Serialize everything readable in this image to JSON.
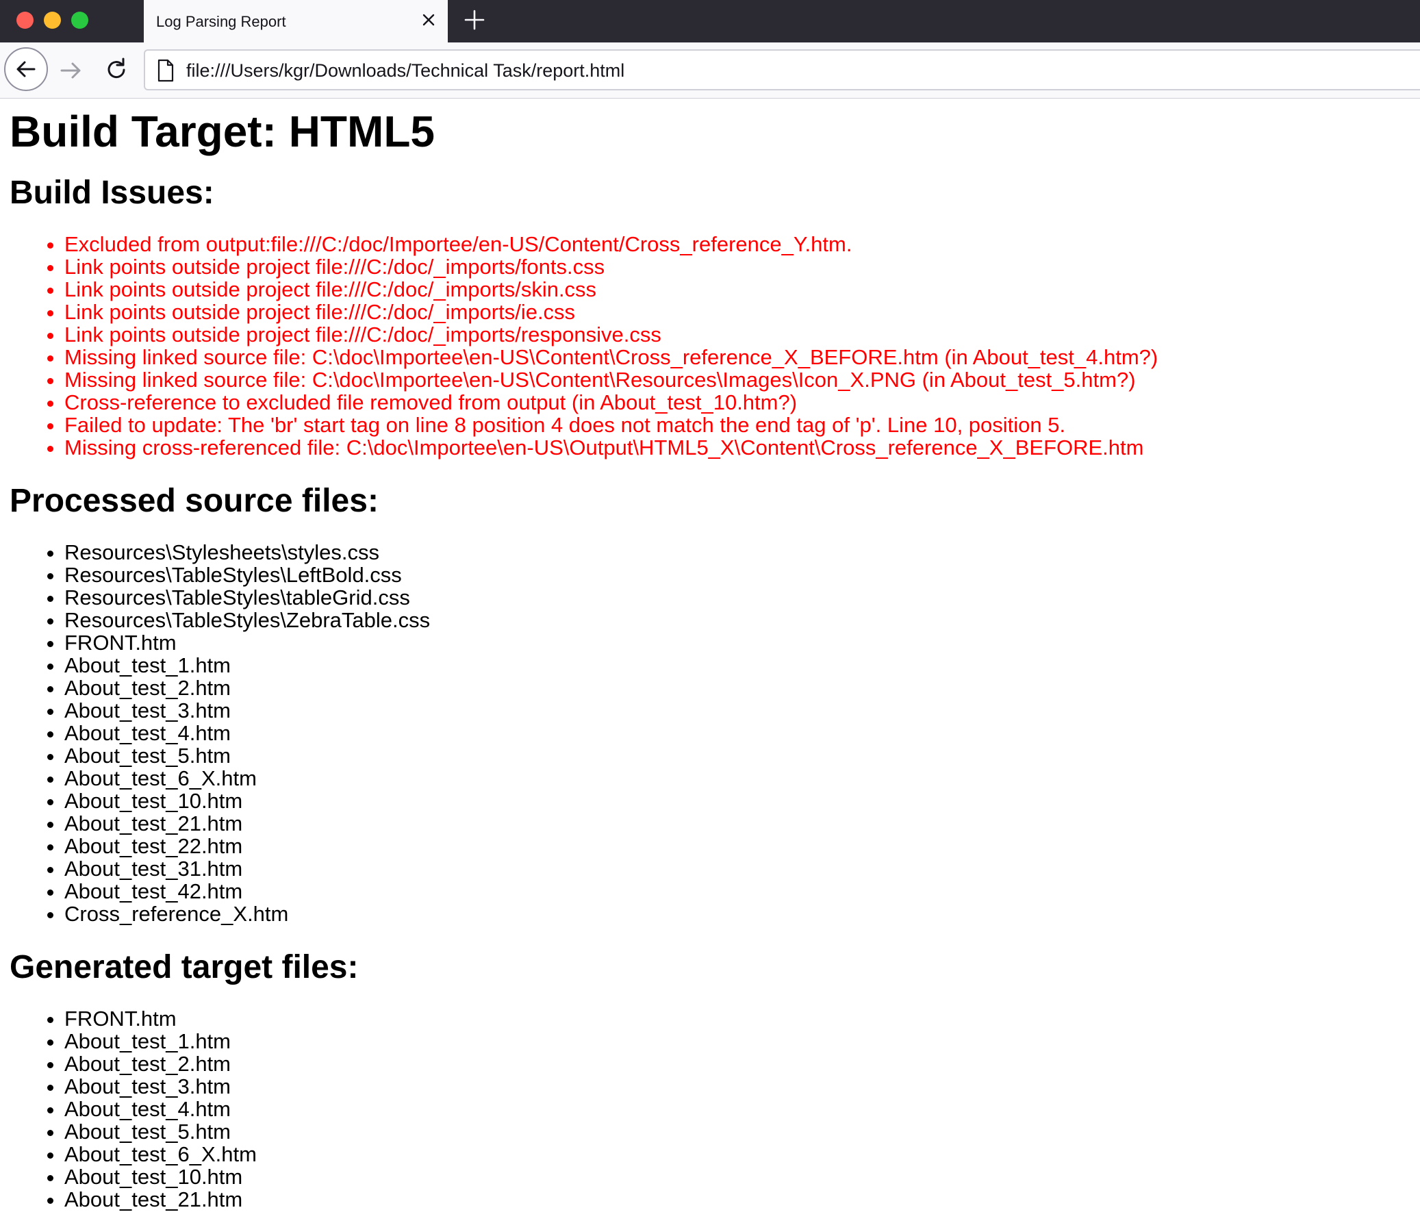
{
  "browser": {
    "tab_title": "Log Parsing Report",
    "url": "file:///Users/kgr/Downloads/Technical Task/report.html"
  },
  "page": {
    "title": "Build Target: HTML5",
    "issues_heading": "Build Issues:",
    "issues": [
      "Excluded from output:file:///C:/doc/Importee/en-US/Content/Cross_reference_Y.htm.",
      "Link points outside project file:///C:/doc/_imports/fonts.css",
      "Link points outside project file:///C:/doc/_imports/skin.css",
      "Link points outside project file:///C:/doc/_imports/ie.css",
      "Link points outside project file:///C:/doc/_imports/responsive.css",
      "Missing linked source file: C:\\doc\\Importee\\en-US\\Content\\Cross_reference_X_BEFORE.htm (in About_test_4.htm?)",
      "Missing linked source file: C:\\doc\\Importee\\en-US\\Content\\Resources\\Images\\Icon_X.PNG (in About_test_5.htm?)",
      "Cross-reference to excluded file removed from output (in About_test_10.htm?)",
      "Failed to update: The 'br' start tag on line 8 position 4 does not match the end tag of 'p'. Line 10, position 5.",
      "Missing cross-referenced file: C:\\doc\\Importee\\en-US\\Output\\HTML5_X\\Content\\Cross_reference_X_BEFORE.htm"
    ],
    "processed_heading": "Processed source files:",
    "processed_files": [
      "Resources\\Stylesheets\\styles.css",
      "Resources\\TableStyles\\LeftBold.css",
      "Resources\\TableStyles\\tableGrid.css",
      "Resources\\TableStyles\\ZebraTable.css",
      "FRONT.htm",
      "About_test_1.htm",
      "About_test_2.htm",
      "About_test_3.htm",
      "About_test_4.htm",
      "About_test_5.htm",
      "About_test_6_X.htm",
      "About_test_10.htm",
      "About_test_21.htm",
      "About_test_22.htm",
      "About_test_31.htm",
      "About_test_42.htm",
      "Cross_reference_X.htm"
    ],
    "generated_heading": "Generated target files:",
    "generated_files": [
      "FRONT.htm",
      "About_test_1.htm",
      "About_test_2.htm",
      "About_test_3.htm",
      "About_test_4.htm",
      "About_test_5.htm",
      "About_test_6_X.htm",
      "About_test_10.htm",
      "About_test_21.htm"
    ]
  }
}
